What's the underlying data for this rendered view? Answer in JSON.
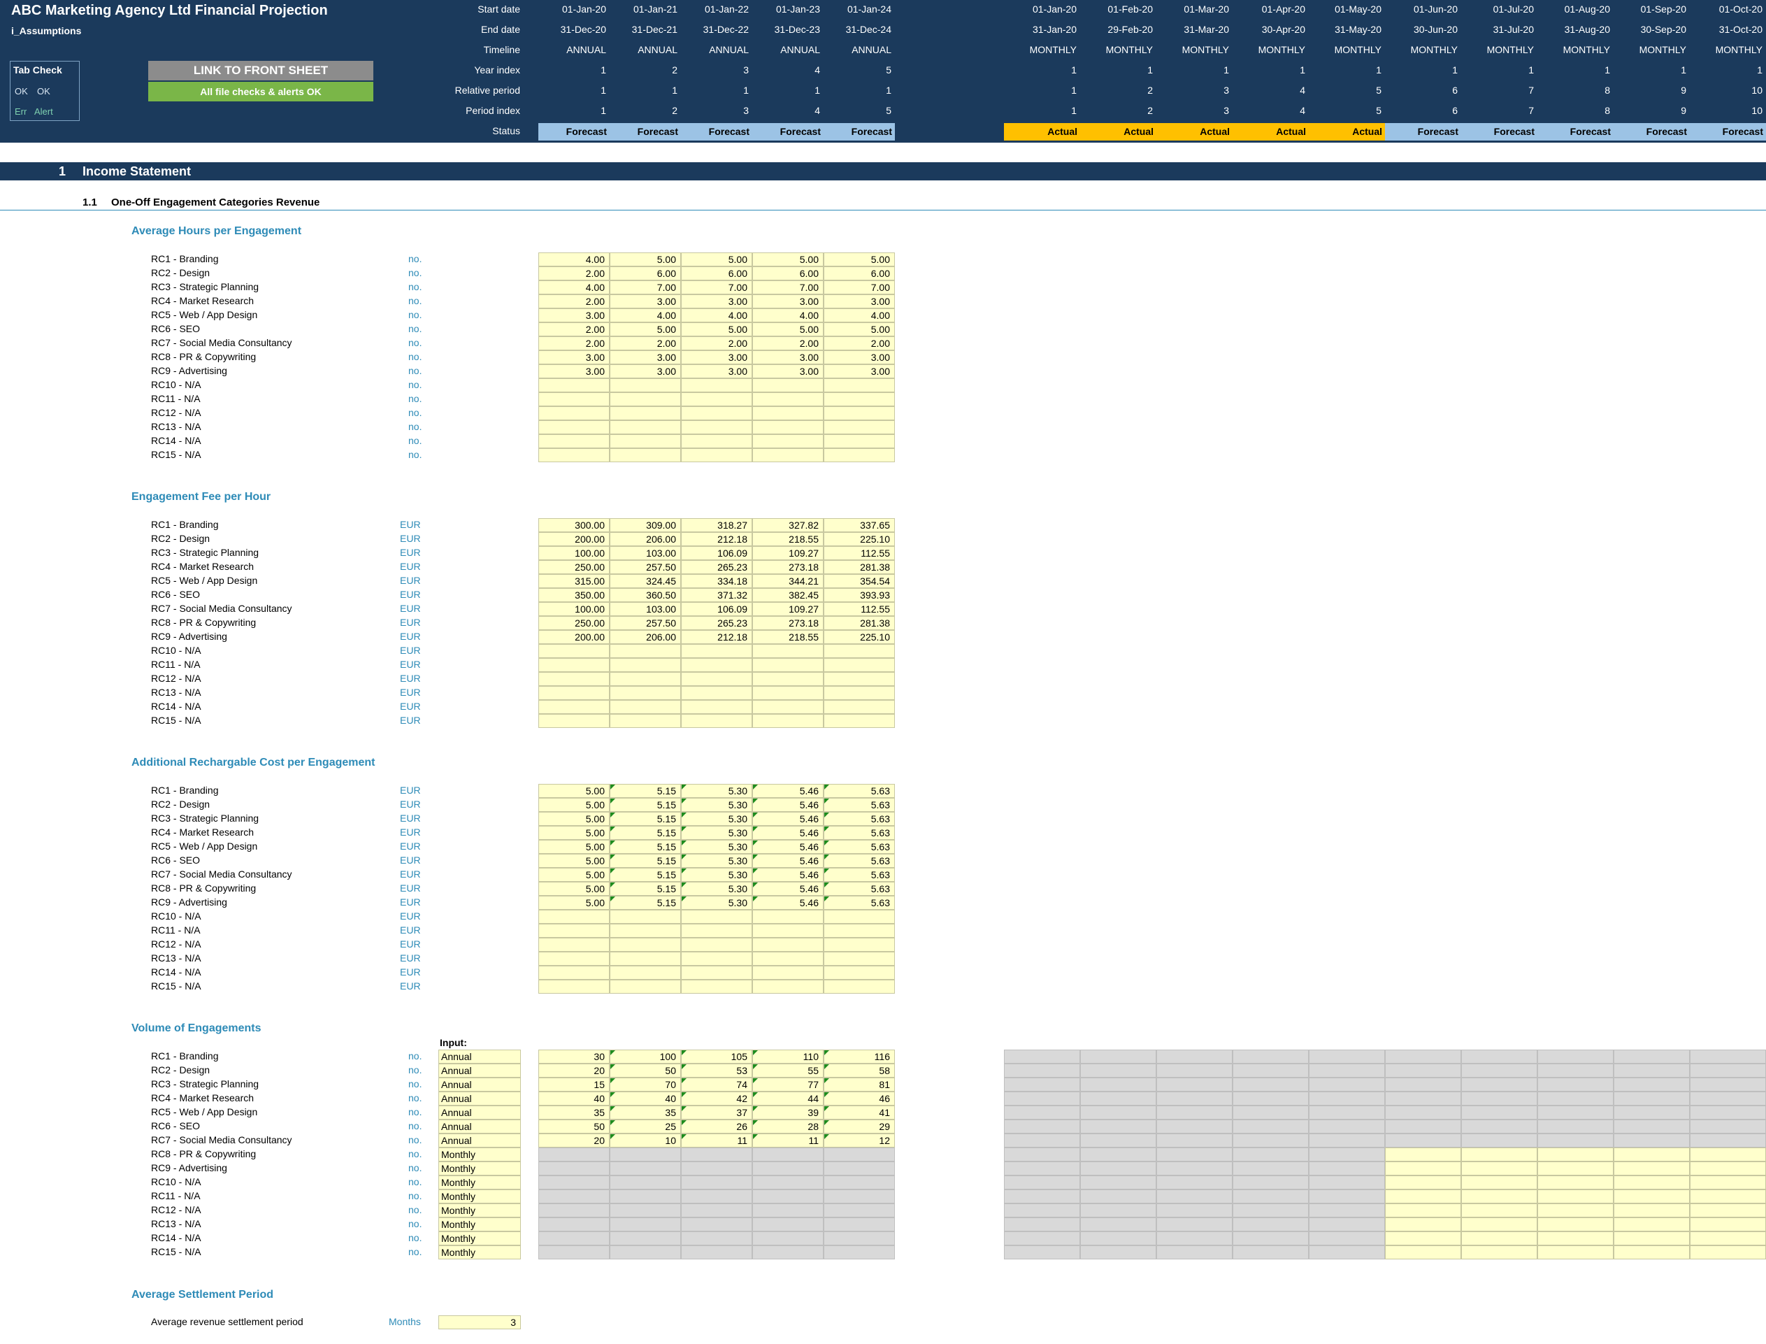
{
  "title": "ABC Marketing Agency Ltd Financial Projection",
  "sheet": "i_Assumptions",
  "tab_check": {
    "title": "Tab Check",
    "ok1": "OK",
    "ok2": "OK",
    "err": "Err",
    "alert": "Alert"
  },
  "link_button": "LINK TO FRONT SHEET",
  "checks_ok": "All file checks & alerts OK",
  "header_labels": {
    "start": "Start date",
    "end": "End date",
    "timeline": "Timeline",
    "year": "Year index",
    "rel": "Relative period",
    "period": "Period index",
    "status": "Status"
  },
  "annual_cols": [
    {
      "start": "01-Jan-20",
      "end": "31-Dec-20",
      "timeline": "ANNUAL",
      "year": "1",
      "rel": "1",
      "period": "1",
      "status": "Forecast"
    },
    {
      "start": "01-Jan-21",
      "end": "31-Dec-21",
      "timeline": "ANNUAL",
      "year": "2",
      "rel": "1",
      "period": "2",
      "status": "Forecast"
    },
    {
      "start": "01-Jan-22",
      "end": "31-Dec-22",
      "timeline": "ANNUAL",
      "year": "3",
      "rel": "1",
      "period": "3",
      "status": "Forecast"
    },
    {
      "start": "01-Jan-23",
      "end": "31-Dec-23",
      "timeline": "ANNUAL",
      "year": "4",
      "rel": "1",
      "period": "4",
      "status": "Forecast"
    },
    {
      "start": "01-Jan-24",
      "end": "31-Dec-24",
      "timeline": "ANNUAL",
      "year": "5",
      "rel": "1",
      "period": "5",
      "status": "Forecast"
    }
  ],
  "monthly_cols": [
    {
      "start": "01-Jan-20",
      "end": "31-Jan-20",
      "timeline": "MONTHLY",
      "year": "1",
      "rel": "1",
      "period": "1",
      "status": "Actual"
    },
    {
      "start": "01-Feb-20",
      "end": "29-Feb-20",
      "timeline": "MONTHLY",
      "year": "1",
      "rel": "2",
      "period": "2",
      "status": "Actual"
    },
    {
      "start": "01-Mar-20",
      "end": "31-Mar-20",
      "timeline": "MONTHLY",
      "year": "1",
      "rel": "3",
      "period": "3",
      "status": "Actual"
    },
    {
      "start": "01-Apr-20",
      "end": "30-Apr-20",
      "timeline": "MONTHLY",
      "year": "1",
      "rel": "4",
      "period": "4",
      "status": "Actual"
    },
    {
      "start": "01-May-20",
      "end": "31-May-20",
      "timeline": "MONTHLY",
      "year": "1",
      "rel": "5",
      "period": "5",
      "status": "Actual"
    },
    {
      "start": "01-Jun-20",
      "end": "30-Jun-20",
      "timeline": "MONTHLY",
      "year": "1",
      "rel": "6",
      "period": "6",
      "status": "Forecast"
    },
    {
      "start": "01-Jul-20",
      "end": "31-Jul-20",
      "timeline": "MONTHLY",
      "year": "1",
      "rel": "7",
      "period": "7",
      "status": "Forecast"
    },
    {
      "start": "01-Aug-20",
      "end": "31-Aug-20",
      "timeline": "MONTHLY",
      "year": "1",
      "rel": "8",
      "period": "8",
      "status": "Forecast"
    },
    {
      "start": "01-Sep-20",
      "end": "30-Sep-20",
      "timeline": "MONTHLY",
      "year": "1",
      "rel": "9",
      "period": "9",
      "status": "Forecast"
    },
    {
      "start": "01-Oct-20",
      "end": "31-Oct-20",
      "timeline": "MONTHLY",
      "year": "1",
      "rel": "10",
      "period": "10",
      "status": "Forecast"
    }
  ],
  "section": {
    "num": "1",
    "title": "Income Statement"
  },
  "subsection": {
    "num": "1.1",
    "title": "One-Off Engagement Categories Revenue"
  },
  "categories": [
    "RC1 - Branding",
    "RC2 - Design",
    "RC3 - Strategic Planning",
    "RC4 - Market Research",
    "RC5 - Web / App Design",
    "RC6 - SEO",
    "RC7 - Social Media Consultancy",
    "RC8 - PR & Copywriting",
    "RC9 - Advertising",
    "RC10 - N/A",
    "RC11 - N/A",
    "RC12 - N/A",
    "RC13 - N/A",
    "RC14 - N/A",
    "RC15 - N/A"
  ],
  "blocks": [
    {
      "title": "Average Hours per Engagement",
      "unit": "no.",
      "flags": false,
      "values": [
        [
          "4.00",
          "5.00",
          "5.00",
          "5.00",
          "5.00"
        ],
        [
          "2.00",
          "6.00",
          "6.00",
          "6.00",
          "6.00"
        ],
        [
          "4.00",
          "7.00",
          "7.00",
          "7.00",
          "7.00"
        ],
        [
          "2.00",
          "3.00",
          "3.00",
          "3.00",
          "3.00"
        ],
        [
          "3.00",
          "4.00",
          "4.00",
          "4.00",
          "4.00"
        ],
        [
          "2.00",
          "5.00",
          "5.00",
          "5.00",
          "5.00"
        ],
        [
          "2.00",
          "2.00",
          "2.00",
          "2.00",
          "2.00"
        ],
        [
          "3.00",
          "3.00",
          "3.00",
          "3.00",
          "3.00"
        ],
        [
          "3.00",
          "3.00",
          "3.00",
          "3.00",
          "3.00"
        ]
      ]
    },
    {
      "title": "Engagement Fee per Hour",
      "unit": "EUR",
      "flags": false,
      "values": [
        [
          "300.00",
          "309.00",
          "318.27",
          "327.82",
          "337.65"
        ],
        [
          "200.00",
          "206.00",
          "212.18",
          "218.55",
          "225.10"
        ],
        [
          "100.00",
          "103.00",
          "106.09",
          "109.27",
          "112.55"
        ],
        [
          "250.00",
          "257.50",
          "265.23",
          "273.18",
          "281.38"
        ],
        [
          "315.00",
          "324.45",
          "334.18",
          "344.21",
          "354.54"
        ],
        [
          "350.00",
          "360.50",
          "371.32",
          "382.45",
          "393.93"
        ],
        [
          "100.00",
          "103.00",
          "106.09",
          "109.27",
          "112.55"
        ],
        [
          "250.00",
          "257.50",
          "265.23",
          "273.18",
          "281.38"
        ],
        [
          "200.00",
          "206.00",
          "212.18",
          "218.55",
          "225.10"
        ]
      ]
    },
    {
      "title": "Additional Rechargable Cost per Engagement",
      "unit": "EUR",
      "flags": true,
      "values": [
        [
          "5.00",
          "5.15",
          "5.30",
          "5.46",
          "5.63"
        ],
        [
          "5.00",
          "5.15",
          "5.30",
          "5.46",
          "5.63"
        ],
        [
          "5.00",
          "5.15",
          "5.30",
          "5.46",
          "5.63"
        ],
        [
          "5.00",
          "5.15",
          "5.30",
          "5.46",
          "5.63"
        ],
        [
          "5.00",
          "5.15",
          "5.30",
          "5.46",
          "5.63"
        ],
        [
          "5.00",
          "5.15",
          "5.30",
          "5.46",
          "5.63"
        ],
        [
          "5.00",
          "5.15",
          "5.30",
          "5.46",
          "5.63"
        ],
        [
          "5.00",
          "5.15",
          "5.30",
          "5.46",
          "5.63"
        ],
        [
          "5.00",
          "5.15",
          "5.30",
          "5.46",
          "5.63"
        ]
      ]
    }
  ],
  "volume": {
    "title": "Volume of Engagements",
    "unit": "no.",
    "input_header": "Input:",
    "inputs": [
      "Annual",
      "Annual",
      "Annual",
      "Annual",
      "Annual",
      "Annual",
      "Annual",
      "Monthly",
      "Monthly",
      "Monthly",
      "Monthly",
      "Monthly",
      "Monthly",
      "Monthly",
      "Monthly"
    ],
    "values": [
      [
        "30",
        "100",
        "105",
        "110",
        "116"
      ],
      [
        "20",
        "50",
        "53",
        "55",
        "58"
      ],
      [
        "15",
        "70",
        "74",
        "77",
        "81"
      ],
      [
        "40",
        "40",
        "42",
        "44",
        "46"
      ],
      [
        "35",
        "35",
        "37",
        "39",
        "41"
      ],
      [
        "50",
        "25",
        "26",
        "28",
        "29"
      ],
      [
        "20",
        "10",
        "11",
        "11",
        "12"
      ]
    ]
  },
  "settlement": {
    "title": "Average Settlement Period",
    "label": "Average revenue settlement period",
    "unit": "Months",
    "value": "3"
  }
}
